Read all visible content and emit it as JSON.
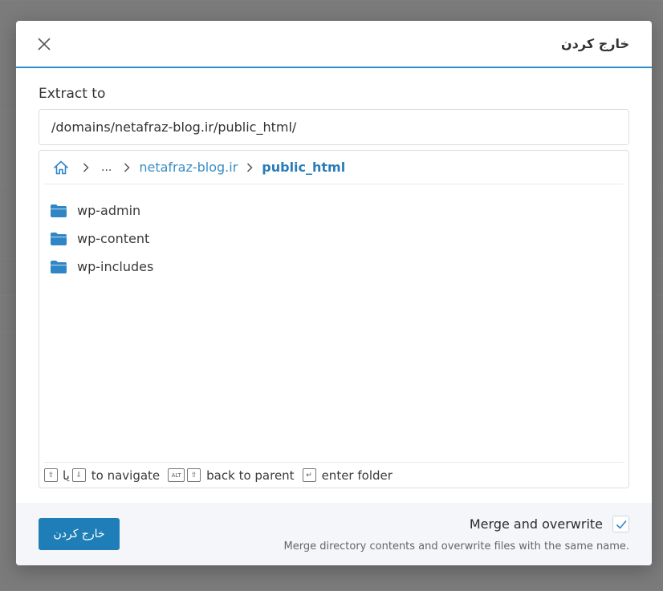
{
  "dialog": {
    "title": "خارج کردن",
    "close_icon": "close-icon"
  },
  "extract": {
    "label": "Extract to",
    "path_value": "/domains/netafraz-blog.ir/public_html/"
  },
  "breadcrumb": {
    "home_icon": "home-icon",
    "ellipsis": "...",
    "items": [
      {
        "label": "netafraz-blog.ir"
      },
      {
        "label": "public_html"
      }
    ]
  },
  "folders": [
    {
      "name": "wp-admin",
      "icon": "folder-icon"
    },
    {
      "name": "wp-content",
      "icon": "folder-icon"
    },
    {
      "name": "wp-includes",
      "icon": "folder-icon"
    }
  ],
  "hints": {
    "up_key": "⇧",
    "or_text": "یا",
    "down_key": "⇩",
    "navigate": "to navigate",
    "alt_key": "ALT",
    "back_key": "⇧",
    "back": "back to parent",
    "enter_key": "↵",
    "enter": "enter folder"
  },
  "footer": {
    "submit_label": "خارج کردن",
    "merge_label": "Merge and overwrite",
    "merge_checked": true,
    "merge_description": "Merge directory contents and overwrite files with the same name."
  },
  "colors": {
    "accent": "#2f8cc8",
    "button": "#1f7eb7",
    "folder": "#2f86c6",
    "link": "#3a8dc4"
  }
}
